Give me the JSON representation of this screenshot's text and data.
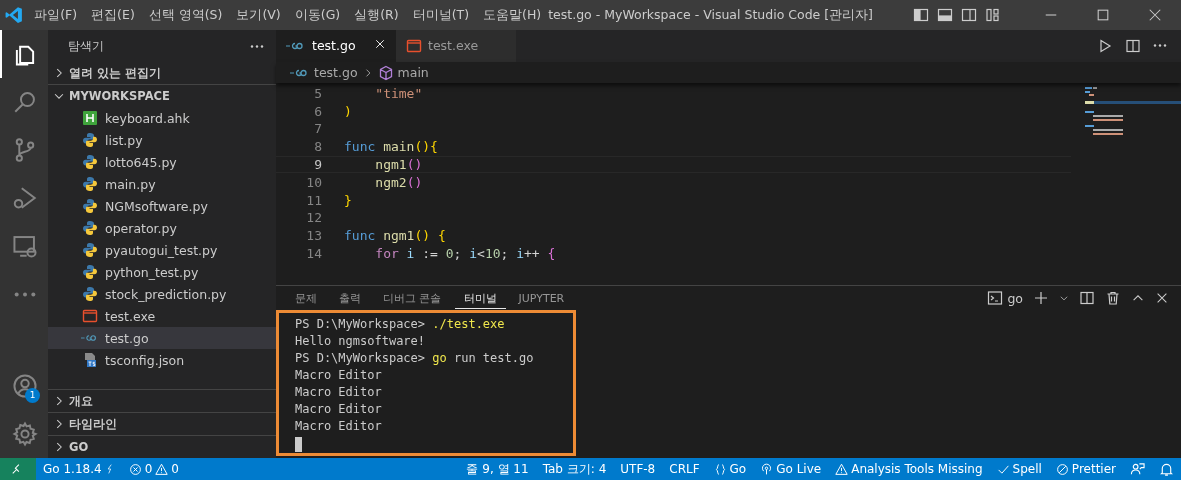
{
  "window": {
    "title": "test.go - MyWorkspace - Visual Studio Code [관리자]"
  },
  "menu": [
    "파일(F)",
    "편집(E)",
    "선택 영역(S)",
    "보기(V)",
    "이동(G)",
    "실행(R)",
    "터미널(T)",
    "도움말(H)"
  ],
  "activity_bar": {
    "items": [
      {
        "kind": "explorer",
        "selected": true
      },
      {
        "kind": "search",
        "selected": false
      },
      {
        "kind": "scm",
        "selected": false
      },
      {
        "kind": "debug",
        "selected": false
      },
      {
        "kind": "remote",
        "selected": false
      },
      {
        "kind": "more",
        "selected": false
      }
    ],
    "account_badge": "1"
  },
  "sidebar": {
    "title": "탐색기",
    "sections": [
      {
        "label": "열려 있는 편집기",
        "expanded": false
      },
      {
        "label": "MYWORKSPACE",
        "expanded": true
      }
    ],
    "files": [
      {
        "name": "keyboard.ahk",
        "kind": "ahk",
        "selected": false
      },
      {
        "name": "list.py",
        "kind": "py",
        "selected": false
      },
      {
        "name": "lotto645.py",
        "kind": "py",
        "selected": false
      },
      {
        "name": "main.py",
        "kind": "py",
        "selected": false
      },
      {
        "name": "NGMsoftware.py",
        "kind": "py",
        "selected": false
      },
      {
        "name": "operator.py",
        "kind": "py",
        "selected": false
      },
      {
        "name": "pyautogui_test.py",
        "kind": "py",
        "selected": false
      },
      {
        "name": "python_test.py",
        "kind": "py",
        "selected": false
      },
      {
        "name": "stock_prediction.py",
        "kind": "py",
        "selected": false
      },
      {
        "name": "test.exe",
        "kind": "exe",
        "selected": false
      },
      {
        "name": "test.go",
        "kind": "go",
        "selected": true
      },
      {
        "name": "tsconfig.json",
        "kind": "ts",
        "selected": false
      }
    ],
    "bottom_sections": [
      {
        "label": "개요",
        "expanded": false
      },
      {
        "label": "타임라인",
        "expanded": false
      },
      {
        "label": "GO",
        "expanded": false
      }
    ]
  },
  "tabs": [
    {
      "label": "test.go",
      "kind": "go",
      "selected": true
    },
    {
      "label": "test.exe",
      "kind": "exe",
      "selected": false
    }
  ],
  "breadcrumb": [
    {
      "label": "test.go",
      "kind": "go"
    },
    {
      "label": "main",
      "kind": "symbol"
    }
  ],
  "code": [
    {
      "number": "5",
      "current": false,
      "tokens": [
        {
          "text": "    \"time\"",
          "kind": "string"
        }
      ]
    },
    {
      "number": "6",
      "current": false,
      "tokens": [
        {
          "text": ")",
          "kind": "paren1"
        }
      ]
    },
    {
      "number": "7",
      "current": false
    },
    {
      "number": "8",
      "current": false,
      "tokens": [
        {
          "text": "func",
          "kind": "keyword"
        },
        {
          "text": " main",
          "kind": "function"
        },
        {
          "text": "(){",
          "kind": "paren1"
        }
      ]
    },
    {
      "number": "9",
      "current": true,
      "tokens": [
        {
          "text": "    ngm1",
          "kind": "function"
        },
        {
          "text": "()",
          "kind": "paren2"
        }
      ]
    },
    {
      "number": "10",
      "current": false,
      "tokens": [
        {
          "text": "    ngm2",
          "kind": "function"
        },
        {
          "text": "()",
          "kind": "paren2"
        }
      ]
    },
    {
      "number": "11",
      "current": false,
      "tokens": [
        {
          "text": "}",
          "kind": "paren1"
        }
      ]
    },
    {
      "number": "12",
      "current": false
    },
    {
      "number": "13",
      "current": false,
      "tokens": [
        {
          "text": "func",
          "kind": "keyword"
        },
        {
          "text": " ngm1",
          "kind": "function"
        },
        {
          "text": "() {",
          "kind": "paren1"
        }
      ]
    },
    {
      "number": "14",
      "current": false,
      "tokens": [
        {
          "text": "    for",
          "kind": "control"
        },
        {
          "text": " i",
          "kind": "variable"
        },
        {
          "text": " := ",
          "kind": "plain"
        },
        {
          "text": "0",
          "kind": "number"
        },
        {
          "text": "; ",
          "kind": "plain"
        },
        {
          "text": "i",
          "kind": "variable"
        },
        {
          "text": "<",
          "kind": "plain"
        },
        {
          "text": "10",
          "kind": "number"
        },
        {
          "text": "; ",
          "kind": "plain"
        },
        {
          "text": "i",
          "kind": "variable"
        },
        {
          "text": "++ ",
          "kind": "plain"
        },
        {
          "text": "{",
          "kind": "paren2"
        }
      ]
    }
  ],
  "panel": {
    "tabs": [
      {
        "label": "문제",
        "selected": false
      },
      {
        "label": "출력",
        "selected": false
      },
      {
        "label": "디버그 콘솔",
        "selected": false
      },
      {
        "label": "터미널",
        "selected": true
      },
      {
        "label": "JUPYTER",
        "selected": false
      }
    ],
    "terminal_name": "go",
    "terminal": [
      {
        "prompt": "PS D:\\MyWorkspace> ",
        "command": "./test.exe"
      },
      {
        "output": "Hello ngmsoftware!"
      },
      {
        "prompt": "PS D:\\MyWorkspace> ",
        "command": "go",
        "args": " run test.go"
      },
      {
        "output": "Macro Editor"
      },
      {
        "output": "Macro Editor"
      },
      {
        "output": "Macro Editor"
      },
      {
        "output": "Macro Editor"
      }
    ]
  },
  "status_bar": {
    "go_version": "Go 1.18.4",
    "errors": "0",
    "warnings": "0",
    "right": [
      {
        "text": "줄 9, 열 11",
        "kind": "text"
      },
      {
        "text": "Tab 크기: 4",
        "kind": "text"
      },
      {
        "text": "UTF-8",
        "kind": "text"
      },
      {
        "text": "CRLF",
        "kind": "text"
      },
      {
        "text": "Go",
        "kind": "braces"
      },
      {
        "text": "Go Live",
        "kind": "live"
      },
      {
        "text": "Analysis Tools Missing",
        "kind": "warning"
      },
      {
        "text": "Spell",
        "kind": "check"
      },
      {
        "text": "Prettier",
        "kind": "prettier"
      },
      {
        "kind": "feedback"
      },
      {
        "kind": "bell"
      }
    ]
  }
}
